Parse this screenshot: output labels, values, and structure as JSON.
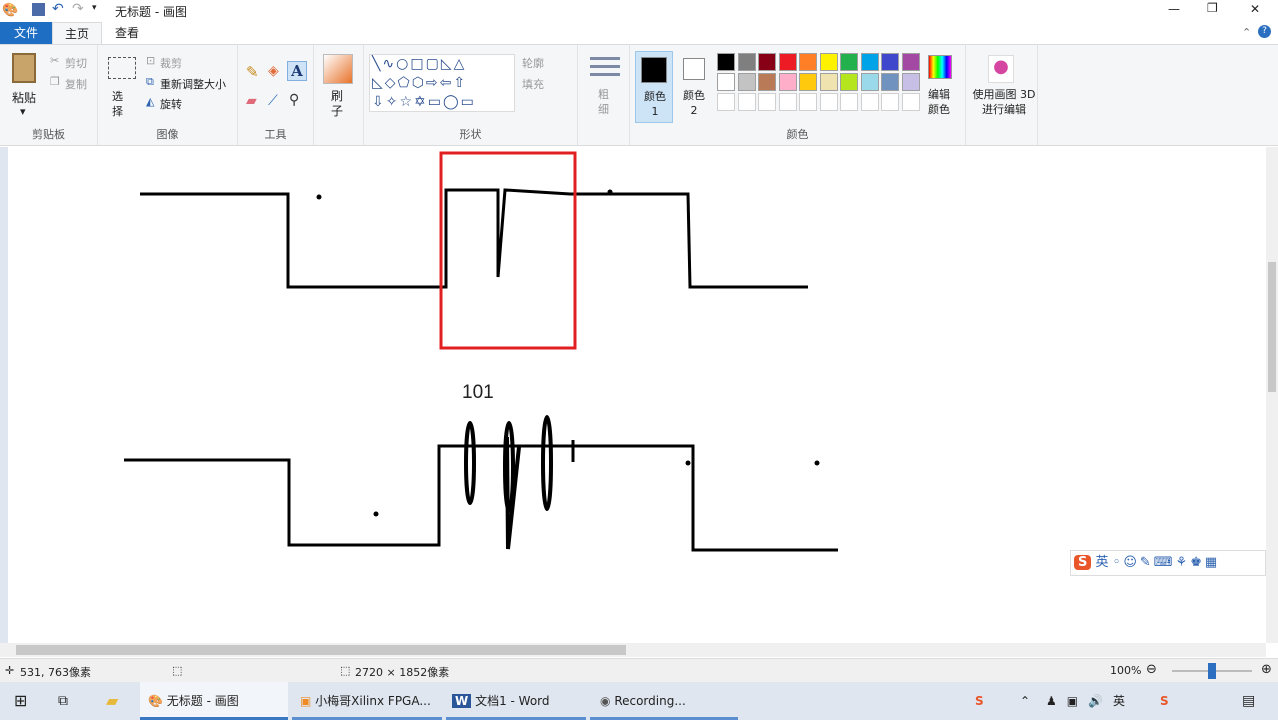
{
  "window": {
    "title": "无标题 - 画图",
    "min": "—",
    "restore": "❐",
    "close": "✕"
  },
  "tabs": [
    {
      "label": "文件"
    },
    {
      "label": "主页"
    },
    {
      "label": "查看"
    }
  ],
  "ribbon": {
    "clipboard": {
      "paste": "粘贴",
      "cut": "剪切",
      "copy": "复制",
      "label": "剪贴板"
    },
    "image": {
      "select": "选择",
      "crop": "裁剪",
      "resize": "重新调整大小",
      "rotate": "旋转",
      "label": "图像"
    },
    "tools": {
      "label": "工具"
    },
    "brushes": {
      "label": "刷子"
    },
    "shapes": {
      "outline": "轮廓",
      "fill": "填充",
      "label": "形状"
    },
    "size": {
      "label": "粗细"
    },
    "colors": {
      "color1": "颜色 1",
      "color2": "颜色 2",
      "edit": "编辑颜色",
      "label": "颜色",
      "palette": [
        "#000000",
        "#7f7f7f",
        "#880015",
        "#ed1c24",
        "#ff7f27",
        "#fff200",
        "#22b14c",
        "#00a2e8",
        "#3f48cc",
        "#a349a4",
        "#ffffff",
        "#c3c3c3",
        "#b97a57",
        "#ffaec9",
        "#ffc90e",
        "#efe4b0",
        "#b5e61d",
        "#99d9ea",
        "#7092be",
        "#c8bfe7"
      ]
    },
    "paint3d": {
      "label": "使用画图 3D 进行编辑"
    }
  },
  "canvas": {
    "text": "101",
    "selection_color": "#e02020"
  },
  "status": {
    "cursor": "531, 763像素",
    "size": "2720 × 1852像素",
    "zoom": "100%",
    "zoom_level": 0.5
  },
  "taskbar": {
    "items": [
      {
        "label": "无标题 - 画图"
      },
      {
        "label": "小梅哥Xilinx FPGA..."
      },
      {
        "label": "文档1 - Word"
      },
      {
        "label": "Recording..."
      }
    ],
    "ime": "英"
  }
}
